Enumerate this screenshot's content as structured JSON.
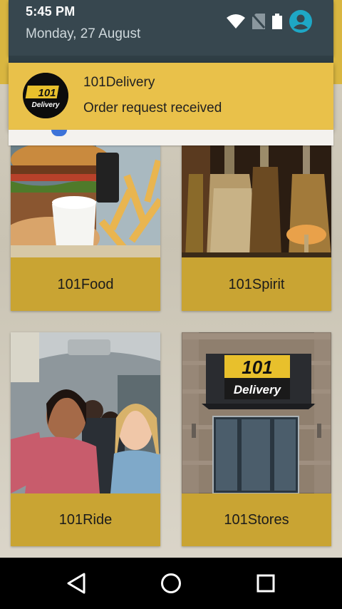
{
  "status_bar": {
    "time": "5:45 PM",
    "date": "Monday, 27 August",
    "icons": [
      "wifi-icon",
      "no-sim-icon",
      "battery-icon",
      "account-icon"
    ]
  },
  "notification": {
    "app_name": "101Delivery",
    "message": "Order request received",
    "logo_text_top": "101",
    "logo_text_bottom": "Delivery"
  },
  "tiles": [
    {
      "label": "101Food",
      "image": "burger-and-fries-photo"
    },
    {
      "label": "101Spirit",
      "image": "liquor-bottles-photo"
    },
    {
      "label": "101Ride",
      "image": "friends-in-car-photo"
    },
    {
      "label": "101Stores",
      "image": "store-front-photo"
    }
  ],
  "store_sign": {
    "top": "101",
    "bottom": "Delivery"
  },
  "nav_bar": {
    "buttons": [
      "back-icon",
      "home-icon",
      "recents-icon"
    ]
  },
  "colors": {
    "accent_yellow": "#e9c14a",
    "tile_label": "#c9a433",
    "shade": "#37474f",
    "account_icon": "#1ea7c5"
  }
}
